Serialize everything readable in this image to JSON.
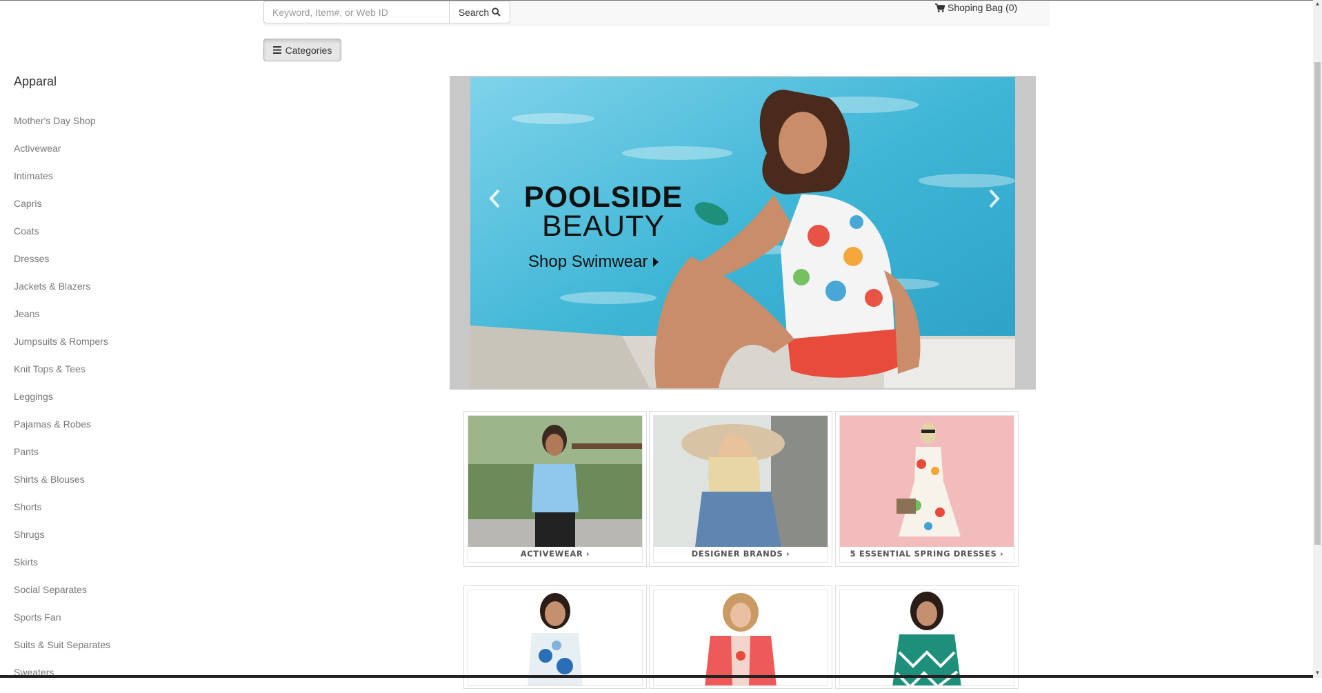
{
  "header": {
    "search_placeholder": "Keyword, Item#, or Web ID",
    "search_button": "Search",
    "cart_label": "Shoping Bag (0)"
  },
  "categories_button": "Categories",
  "sidebar": {
    "title": "Apparal",
    "items": [
      "Mother's Day Shop",
      "Activewear",
      "Intimates",
      "Capris",
      "Coats",
      "Dresses",
      "Jackets & Blazers",
      "Jeans",
      "Jumpsuits & Rompers",
      "Knit Tops & Tees",
      "Leggings",
      "Pajamas & Robes",
      "Pants",
      "Shirts & Blouses",
      "Shorts",
      "Shrugs",
      "Skirts",
      "Social Separates",
      "Sports Fan",
      "Suits & Suit Separates",
      "Sweaters"
    ]
  },
  "carousel": {
    "title": "POOLSIDE",
    "subtitle": "BEAUTY",
    "cta": "Shop Swimwear",
    "prev_icon": "chevron-left-icon",
    "next_icon": "chevron-right-icon"
  },
  "tiles": [
    {
      "label": "ACTIVEWEAR ›"
    },
    {
      "label": "DESIGNER BRANDS ›"
    },
    {
      "label": "5 ESSENTIAL SPRING DRESSES ›"
    }
  ],
  "colors": {
    "pool": "#3fb6d6",
    "swimsuit_red": "#e84b3c",
    "tile_pink": "#f3bcbc",
    "coral_top": "#ee5a5a",
    "teal_top": "#1e8f7a"
  }
}
